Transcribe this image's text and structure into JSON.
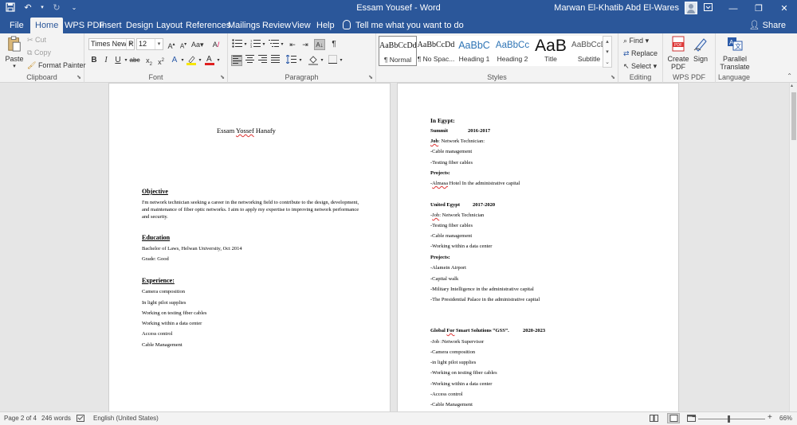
{
  "window": {
    "title": "Essam Yousef  -  Word",
    "user": "Marwan El-Khatib Abd El-Wares"
  },
  "tabs": [
    "File",
    "Home",
    "WPS PDF",
    "Insert",
    "Design",
    "Layout",
    "References",
    "Mailings",
    "Review",
    "View",
    "Help"
  ],
  "active_tab": "Home",
  "tell_me": "Tell me what you want to do",
  "share": "Share",
  "ribbon": {
    "clipboard": {
      "paste": "Paste",
      "cut": "Cut",
      "copy": "Copy",
      "format_painter": "Format Painter",
      "label": "Clipboard"
    },
    "font": {
      "name": "Times New R",
      "size": "12",
      "label": "Font"
    },
    "paragraph": {
      "label": "Paragraph"
    },
    "styles": {
      "items": [
        {
          "preview": "AaBbCcDd",
          "name": "¶ Normal"
        },
        {
          "preview": "AaBbCcDd",
          "name": "¶ No Spac..."
        },
        {
          "preview": "AaBbC",
          "name": "Heading 1"
        },
        {
          "preview": "AaBbCc",
          "name": "Heading 2"
        },
        {
          "preview": "AaB",
          "name": "Title"
        },
        {
          "preview": "AaBbCcD",
          "name": "Subtitle"
        }
      ],
      "label": "Styles"
    },
    "editing": {
      "find": "Find",
      "replace": "Replace",
      "select": "Select",
      "label": "Editing"
    },
    "wps": {
      "create_pdf_1": "Create",
      "create_pdf_2": "PDF",
      "sign": "Sign",
      "label": "WPS PDF"
    },
    "language": {
      "translate_1": "Parallel",
      "translate_2": "Translate",
      "label": "Language"
    }
  },
  "page1": {
    "name_prefix": "Essam ",
    "name_squiggle": "Yossef",
    "name_suffix": " Hanafy",
    "objective_heading": "Objective",
    "objective_text": "I'm network technician seeking a career in the networking field to contribute to the design, development, and maintenance of fiber optic networks. I aim to apply my expertise to improving network performance and security.",
    "education_heading": "Education",
    "education_lines": [
      "Bachelor of Laws, Helwan University, Oct 2014",
      "Grade: Good"
    ],
    "experience_heading": "Experience:",
    "experience_items": [
      "Camera composition",
      "In light pilot supplies",
      "Working on testing fiber cables",
      "Working within a data center",
      "Access control",
      "Cable Management"
    ]
  },
  "page2": {
    "in_egypt": "In Egypt:",
    "summit": {
      "company": "Summit",
      "years": "2016-2017",
      "job_label": "Job",
      "job_text": ": Network Technician:",
      "items": [
        "-Cable management",
        "-Testing fiber cables"
      ],
      "projects": "Projects:",
      "project_prefix": "-",
      "project_squiggle": "Almasa",
      "project_suffix": " Hotel In the administrative capital"
    },
    "united": {
      "company": "United Egypt",
      "years": "2017-2020",
      "job_prefix": "-",
      "job_label": "Job",
      "job_text": ": Network Technician",
      "items": [
        "-Testing fiber cables",
        "-Cable management",
        "-Working within a data center"
      ],
      "projects": "Projects:",
      "project_items": [
        "-Alamein Airport",
        "-Capital walk",
        "-Military Intelligence in the administrative capital",
        "-The Presidential Palace in the administrative capital"
      ]
    },
    "global": {
      "company_prefix": "Global ",
      "company_squiggle": "For",
      "company_suffix": " Smart Solutions “GSS”.",
      "years": "2020-2023",
      "items": [
        "-Job :Network Supervisor",
        "-Camera composition",
        "-in light pilot supplies",
        "-Working on testing fiber cables",
        "-Working within a data center",
        "-Access control",
        "-Cable Management"
      ]
    }
  },
  "status": {
    "page": "Page 2 of 4",
    "words": "246 words",
    "language": "English (United States)",
    "zoom": "66%"
  }
}
